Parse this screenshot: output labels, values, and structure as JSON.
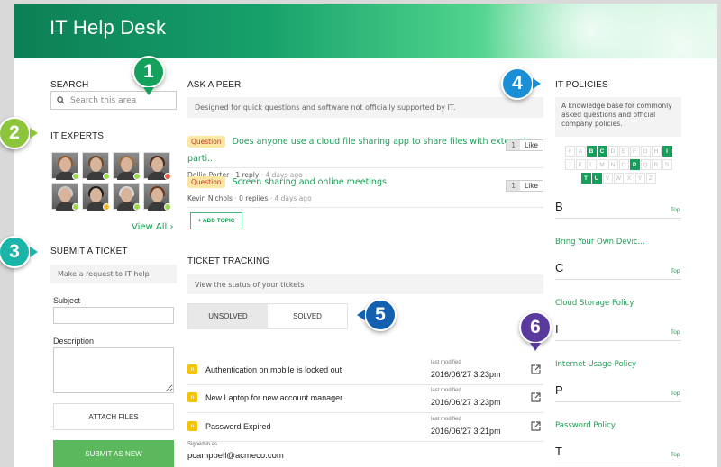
{
  "header": {
    "title": "IT Help Desk"
  },
  "search": {
    "heading": "SEARCH",
    "placeholder": "Search this area",
    "icon": "search-icon"
  },
  "experts": {
    "heading": "IT EXPERTS",
    "view_all": "View All ›",
    "people": [
      {
        "status": "online",
        "status_color": "#9ad94a",
        "hair": "#8a5a36"
      },
      {
        "status": "online",
        "status_color": "#9ad94a",
        "hair": "#6b4a2e"
      },
      {
        "status": "online",
        "status_color": "#9ad94a",
        "hair": "#9a7040"
      },
      {
        "status": "busy",
        "status_color": "#ef5a4a",
        "hair": "#4a2e1e"
      },
      {
        "status": "online",
        "status_color": "#9ad94a",
        "hair": "#c9c9c9"
      },
      {
        "status": "away",
        "status_color": "#f2b632",
        "hair": "#1e1e1e"
      },
      {
        "status": "online",
        "status_color": "#9ad94a",
        "hair": "#d8d8d8"
      },
      {
        "status": "online",
        "status_color": "#9ad94a",
        "hair": "#6a3a1e"
      }
    ]
  },
  "ticket_form": {
    "heading": "SUBMIT A TICKET",
    "description": "Make a request to IT help",
    "subject_label": "Subject",
    "subject_value": "",
    "description_label": "Description",
    "description_value": "",
    "attach_label": "ATTACH FILES",
    "submit_label": "SUBMIT AS NEW"
  },
  "peer": {
    "heading": "ASK A PEER",
    "description": "Designed for quick questions and software not officially supported by IT.",
    "topics": [
      {
        "badge": "Question",
        "title": "Does anyone use a cloud file sharing app to share files with external parti...",
        "author": "Dollie Porter",
        "replies": "1 reply",
        "age": "4 days ago",
        "likes": "1",
        "like_label": "Like"
      },
      {
        "badge": "Question",
        "title": "Screen sharing and online meetings",
        "author": "Kevin Nichols",
        "replies": "0 replies",
        "age": "4 days ago",
        "likes": "1",
        "like_label": "Like"
      }
    ],
    "add_topic": "+ ADD TOPIC"
  },
  "tracking": {
    "heading": "TICKET TRACKING",
    "description": "View the status of your tickets",
    "tabs": [
      {
        "label": "UNSOLVED",
        "active": true
      },
      {
        "label": "SOLVED",
        "active": false
      }
    ],
    "tickets": [
      {
        "status": "n",
        "title": "Authentication on mobile is locked out",
        "modified_label": "last modified",
        "modified": "2016/06/27  3:23pm"
      },
      {
        "status": "n",
        "title": "New Laptop for new account manager",
        "modified_label": "last modified",
        "modified": "2016/06/27  3:23pm"
      },
      {
        "status": "n",
        "title": "Password Expired",
        "modified_label": "last modified",
        "modified": "2016/06/27  3:21pm"
      }
    ],
    "signed_in_label": "Signed in as",
    "signed_in_user": "pcampbell@acmeco.com"
  },
  "policies": {
    "heading": "IT POLICIES",
    "description": "A knowledge base for commonly asked questions and official company policies.",
    "alphabet_rows": [
      [
        {
          "c": "#",
          "on": false
        },
        {
          "c": "A",
          "on": false
        },
        {
          "c": "B",
          "on": true
        },
        {
          "c": "C",
          "on": true
        },
        {
          "c": "D",
          "on": false
        },
        {
          "c": "E",
          "on": false
        },
        {
          "c": "F",
          "on": false
        },
        {
          "c": "G",
          "on": false
        },
        {
          "c": "H",
          "on": false
        },
        {
          "c": "I",
          "on": true
        }
      ],
      [
        {
          "c": "J",
          "on": false
        },
        {
          "c": "K",
          "on": false
        },
        {
          "c": "L",
          "on": false
        },
        {
          "c": "M",
          "on": false
        },
        {
          "c": "N",
          "on": false
        },
        {
          "c": "O",
          "on": false
        },
        {
          "c": "P",
          "on": true
        },
        {
          "c": "Q",
          "on": false
        },
        {
          "c": "R",
          "on": false
        },
        {
          "c": "S",
          "on": false
        }
      ],
      [
        {
          "c": "T",
          "on": true
        },
        {
          "c": "U",
          "on": true
        },
        {
          "c": "V",
          "on": false
        },
        {
          "c": "W",
          "on": false
        },
        {
          "c": "X",
          "on": false
        },
        {
          "c": "Y",
          "on": false
        },
        {
          "c": "Z",
          "on": false
        }
      ]
    ],
    "sections": [
      {
        "letter": "B",
        "top": "Top",
        "link": "Bring Your Own Devic..."
      },
      {
        "letter": "C",
        "top": "Top",
        "link": "Cloud Storage Policy"
      },
      {
        "letter": "I",
        "top": "Top",
        "link": "Internet Usage Policy"
      },
      {
        "letter": "P",
        "top": "Top",
        "link": "Password Policy"
      },
      {
        "letter": "T",
        "top": "Top",
        "link": ""
      }
    ]
  },
  "callouts": [
    {
      "n": "1",
      "color": "#15a05c"
    },
    {
      "n": "2",
      "color": "#8cc43c"
    },
    {
      "n": "3",
      "color": "#1ab5a8"
    },
    {
      "n": "4",
      "color": "#1a8fd6"
    },
    {
      "n": "5",
      "color": "#1460b0"
    },
    {
      "n": "6",
      "color": "#5b3a9e"
    }
  ]
}
